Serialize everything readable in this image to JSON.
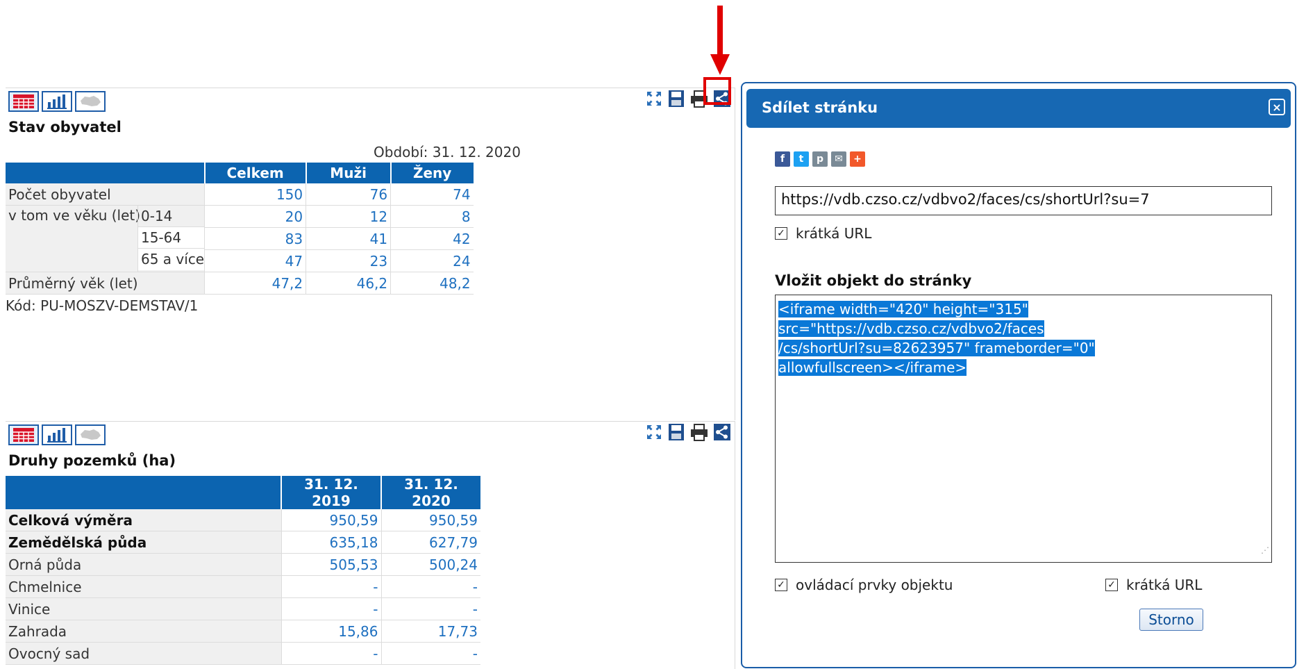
{
  "panel1": {
    "title": "Stav obyvatel",
    "period": "Období: 31. 12. 2020",
    "columns": [
      "Celkem",
      "Muži",
      "Ženy"
    ],
    "rows": [
      {
        "label": "Počet obyvatel",
        "sub": "",
        "values": [
          "150",
          "76",
          "74"
        ]
      },
      {
        "label": "v tom ve věku (let)",
        "sub": "0-14",
        "values": [
          "20",
          "12",
          "8"
        ]
      },
      {
        "label": "",
        "sub": "15-64",
        "values": [
          "83",
          "41",
          "42"
        ]
      },
      {
        "label": "",
        "sub": "65 a více",
        "values": [
          "47",
          "23",
          "24"
        ]
      },
      {
        "label": "Průměrný věk (let)",
        "sub": "",
        "values": [
          "47,2",
          "46,2",
          "48,2"
        ]
      }
    ],
    "code": "Kód: PU-MOSZV-DEMSTAV/1"
  },
  "panel2": {
    "title": "Druhy pozemků (ha)",
    "columns": [
      "31. 12. 2019",
      "31. 12. 2020"
    ],
    "rows": [
      {
        "label": "Celková výměra",
        "values": [
          "950,59",
          "950,59"
        ]
      },
      {
        "label": "Zemědělská půda",
        "values": [
          "635,18",
          "627,79"
        ]
      },
      {
        "label": "Orná půda",
        "values": [
          "505,53",
          "500,24"
        ]
      },
      {
        "label": "Chmelnice",
        "values": [
          "-",
          "-"
        ]
      },
      {
        "label": "Vinice",
        "values": [
          "-",
          "-"
        ]
      },
      {
        "label": "Zahrada",
        "values": [
          "15,86",
          "17,73"
        ]
      },
      {
        "label": "Ovocný sad",
        "values": [
          "-",
          "-"
        ]
      }
    ]
  },
  "icons": {
    "view_table": "table-icon",
    "view_chart": "bar-chart-icon",
    "view_map": "map-icon",
    "fullscreen": "fullscreen-icon",
    "save": "save-icon",
    "print": "print-icon",
    "share": "share-icon"
  },
  "dialog": {
    "title": "Sdílet stránku",
    "close": "×",
    "social": [
      "f",
      "t",
      "p",
      "✉",
      "+"
    ],
    "url_value": "https://vdb.czso.cz/vdbvo2/faces/cs/shortUrl?su=7",
    "short_url_label": "krátká URL",
    "embed_title": "Vložit objekt do stránky",
    "embed_lines": [
      "<iframe width=\"420\" height=\"315\"",
      "src=\"https://vdb.czso.cz/vdbvo2/faces",
      "/cs/shortUrl?su=82623957\" frameborder=\"0\"",
      "allowfullscreen></iframe>"
    ],
    "controls_label": "ovládací prvky objektu",
    "short_url_label2": "krátká URL",
    "cancel": "Storno"
  },
  "colors": {
    "header_blue": "#0c64b0",
    "link_blue": "#1e70c0",
    "annotation_red": "#e00000",
    "selection_blue": "#0a78d7"
  }
}
